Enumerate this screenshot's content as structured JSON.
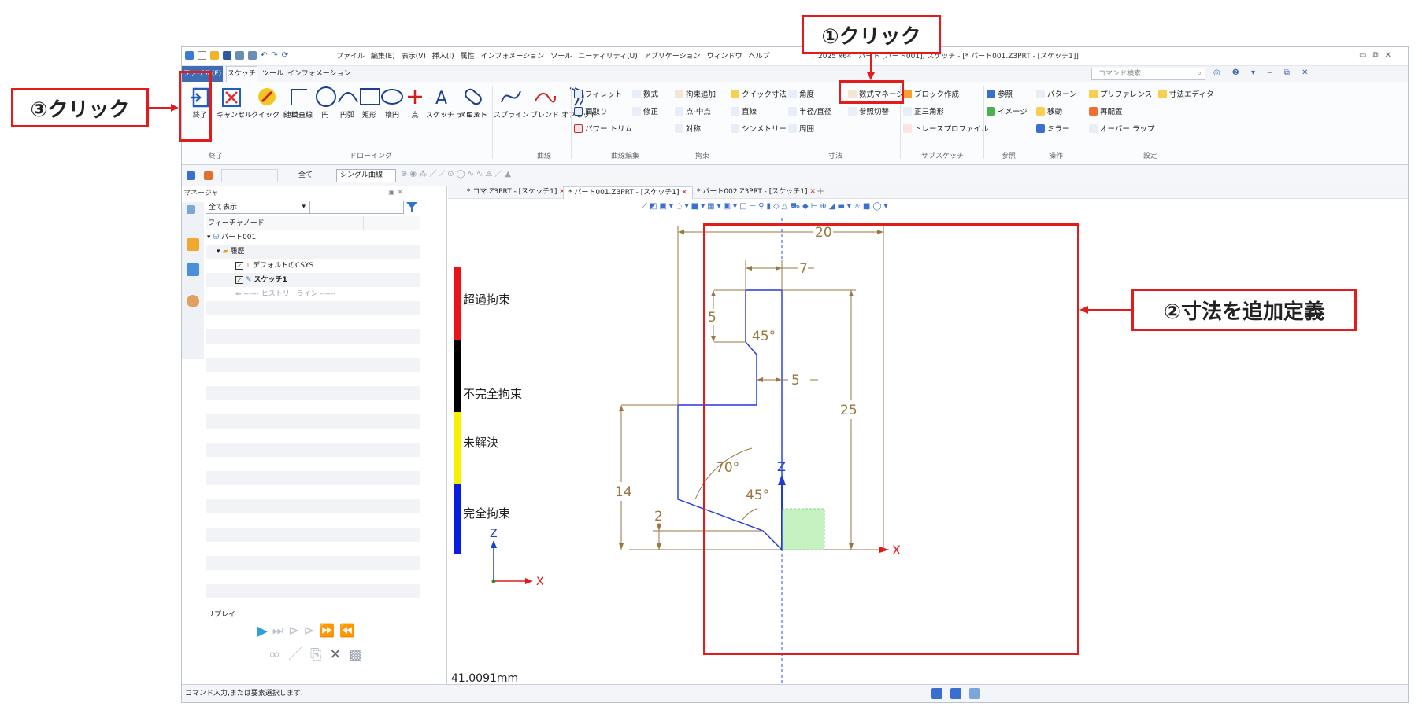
{
  "annotations": {
    "step1": "①クリック",
    "step2": "②寸法を追加定義",
    "step3": "③クリック"
  },
  "window": {
    "menu": [
      "ファイル",
      "編集(E)",
      "表示(V)",
      "挿入(I)",
      "属性",
      "インフォメーション",
      "ツール",
      "ユーティリティ(U)",
      "アプリケーション",
      "ウィンドウ",
      "ヘルプ"
    ],
    "title": "2025 x64　パート [パート001], スケッチ - [* パート001.Z3PRT - [スケッチ1]]",
    "tabs": [
      "ファイル(F)",
      "スケッチ",
      "ツール",
      "インフォメーション"
    ],
    "command_search": "コマンド検索"
  },
  "ribbon": {
    "end": "終了",
    "cancel": "キャンセル",
    "quick_draw": "クイック ド ロー",
    "polyline": "連続直線",
    "circle": "円",
    "arc": "円弧",
    "rect": "矩形",
    "ellipse": "楕円",
    "point": "点",
    "sketch_text": "スケッチ テ キスト",
    "slot": "スロット",
    "spline": "スプライン",
    "blend": "ブレンド",
    "offset": "オフセット",
    "groups": {
      "end": "終了",
      "drawing": "ドローイング",
      "curve": "曲線",
      "curve_edit": "曲線編集",
      "constraint": "拘束",
      "dimension": "寸法",
      "subsketch": "サブスケッチ",
      "reference": "参照",
      "operation": "操作",
      "setting": "設定"
    },
    "curve_edit": [
      "フィレット",
      "面取り",
      "パワー トリム",
      "数式",
      "修正"
    ],
    "constraint": [
      "拘束追加",
      "点-中点",
      "対称",
      "直線",
      "シンメトリー"
    ],
    "dimension": [
      "クイック寸法",
      "角度",
      "半径/直径",
      "周囲",
      "数式マネージャ",
      "参照切替"
    ],
    "subsketch": [
      "ブロック作成",
      "正三角形",
      "トレースプロファイル"
    ],
    "reference": [
      "参照",
      "イメージ"
    ],
    "operation": [
      "パターン",
      "移動",
      "ミラー"
    ],
    "setting": [
      "プリファレンス",
      "再配置",
      "オーバー ラップ",
      "寸法エディタ"
    ]
  },
  "filterbar": {
    "scope": "全て",
    "mode": "シングル曲線"
  },
  "manager": {
    "title": "マネージャ",
    "show_all": "全て表示",
    "column": "フィーチャノード",
    "tree": [
      "パート001",
      "履歴",
      "デフォルトのCSYS",
      "スケッチ1",
      "------ ヒストリーライン ------"
    ],
    "replay": "リプレイ"
  },
  "doc_tabs": [
    "* コマ.Z3PRT - [スケッチ1]",
    "* パート001.Z3PRT - [スケッチ1]",
    "* パート002.Z3PRT - [スケッチ1]"
  ],
  "legend": [
    {
      "label": "超過拘束",
      "color": "#e8141a"
    },
    {
      "label": "不完全拘束",
      "color": "#000000"
    },
    {
      "label": "未解決",
      "color": "#f7f000"
    },
    {
      "label": "完全拘束",
      "color": "#0a1ce0"
    }
  ],
  "dimensions": {
    "d20": "20",
    "d7": "7",
    "d5a": "5",
    "a45a": "45°",
    "d5b": "5",
    "d25": "25",
    "a70": "70°",
    "a45b": "45°",
    "d14": "14",
    "d2": "2"
  },
  "axis": {
    "z": "Z",
    "x": "X"
  },
  "readout": "41.0091mm",
  "status": "コマンド入力,または要素選択します."
}
